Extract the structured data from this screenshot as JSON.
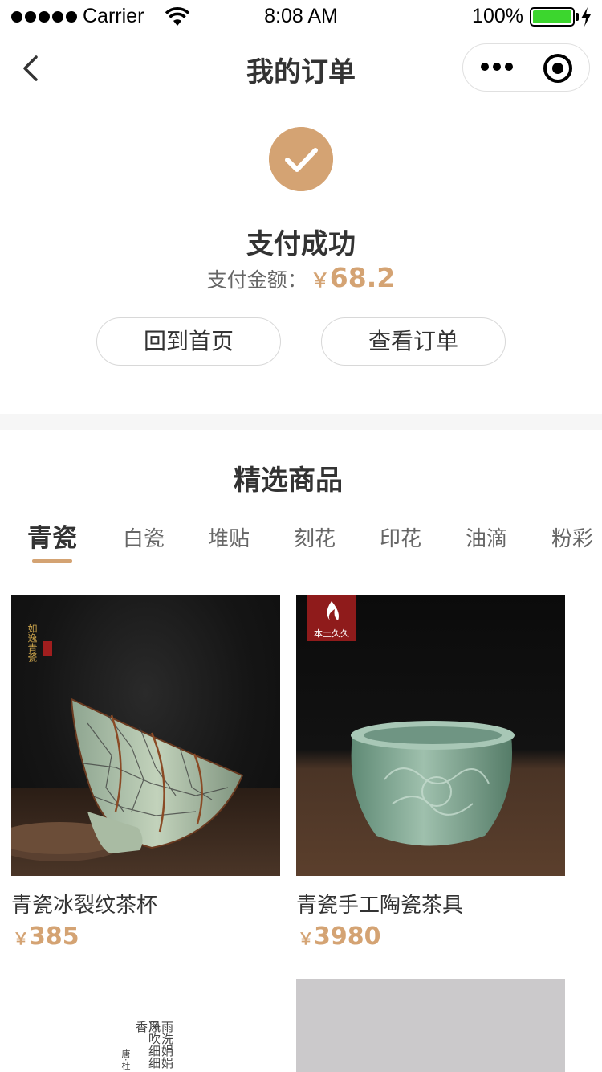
{
  "status_bar": {
    "carrier": "Carrier",
    "time": "8:08 AM",
    "battery_percent": "100%"
  },
  "nav": {
    "title": "我的订单"
  },
  "payment": {
    "status": "支付成功",
    "amount_label": "支付金额：",
    "currency": "￥",
    "amount": "68.2",
    "buttons": {
      "home": "回到首页",
      "view_order": "查看订单"
    }
  },
  "featured": {
    "title": "精选商品",
    "tabs": [
      "青瓷",
      "白瓷",
      "堆贴",
      "刻花",
      "印花",
      "油滴",
      "粉彩"
    ],
    "active_tab": "青瓷",
    "products": [
      {
        "name": "青瓷冰裂纹茶杯",
        "currency": "￥",
        "price": "385",
        "badge": "如逸青瓷"
      },
      {
        "name": "青瓷手工陶瓷茶具",
        "currency": "￥",
        "price": "3980",
        "badge": "本土久久"
      }
    ],
    "partial_poem": [
      "雨洗娟娟净",
      "风吹细细香",
      "唐·杜"
    ]
  },
  "colors": {
    "accent": "#d4a373",
    "battery": "#3cd62e",
    "text_primary": "#333333",
    "text_secondary": "#666666"
  }
}
